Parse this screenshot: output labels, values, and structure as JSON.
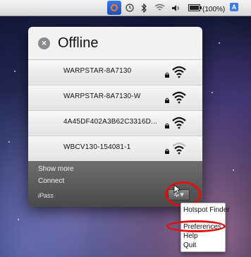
{
  "menubar": {
    "app_icon": "ipass-icon",
    "status_icons": [
      "time-machine-icon",
      "bluetooth-icon",
      "wifi-icon",
      "volume-icon",
      "battery-icon"
    ],
    "battery_text": "(100%)",
    "input_menu_text": "A"
  },
  "panel": {
    "status_icon": "x-circle-icon",
    "status_title": "Offline",
    "networks": [
      {
        "name": "WARPSTAR-8A7130",
        "secured": true,
        "signal": "strong"
      },
      {
        "name": "WARPSTAR-8A7130-W",
        "secured": true,
        "signal": "strong"
      },
      {
        "name": "4A45DF402A3B62C3316D...",
        "secured": true,
        "signal": "strong"
      },
      {
        "name": "WBCV130-154081-1",
        "secured": true,
        "signal": "medium"
      }
    ],
    "footer": {
      "show_more": "Show more",
      "connect": "Connect",
      "brand": "iPass",
      "gear_icon": "gear-icon"
    }
  },
  "context_menu": {
    "items": [
      "Hotspot Finder",
      "Preferences",
      "Help",
      "Quit"
    ]
  },
  "annotations": {
    "color": "#e01010"
  }
}
